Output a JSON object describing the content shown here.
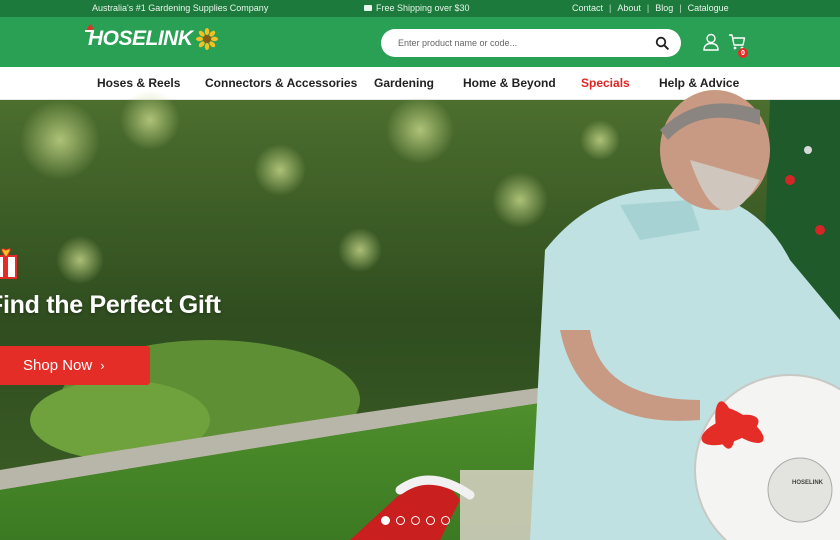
{
  "topbar": {
    "tagline": "Australia's #1 Gardening Supplies Company",
    "shipping": "Free Shipping over $30",
    "links": [
      "Contact",
      "About",
      "Blog",
      "Catalogue"
    ],
    "separator": "|"
  },
  "header": {
    "logo_text": "HOSELINK",
    "search_placeholder": "Enter product name or code...",
    "cart_count": "0",
    "accent_color": "#2aa055",
    "topbar_color": "#1c7a3c"
  },
  "nav": {
    "items": [
      {
        "label": "Hoses & Reels"
      },
      {
        "label": "Connectors & Accessories"
      },
      {
        "label": "Gardening"
      },
      {
        "label": "Home & Beyond"
      },
      {
        "label": "Specials"
      },
      {
        "label": "Help & Advice"
      }
    ]
  },
  "hero": {
    "title": "Find the Perfect Gift",
    "cta_label": "Shop Now",
    "cta_color": "#e52d27",
    "slides_total": 5,
    "active_slide": 1,
    "product_stamp": "HOSELINK"
  }
}
